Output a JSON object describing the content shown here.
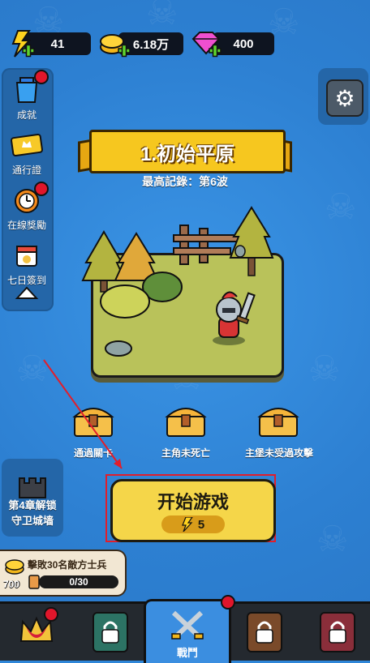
{
  "resources": {
    "energy": "41",
    "gold": "6.18万",
    "gems": "400"
  },
  "side_menu": {
    "items": [
      {
        "label": "成就",
        "icon": "achievement-icon"
      },
      {
        "label": "通行證",
        "icon": "pass-icon"
      },
      {
        "label": "在線獎勵",
        "icon": "online-reward-icon"
      },
      {
        "label": "七日簽到",
        "icon": "calendar-icon"
      }
    ]
  },
  "stage": {
    "title": "1.初始平原",
    "record": "最高記錄：第6波"
  },
  "chests": [
    {
      "label": "通過關卡"
    },
    {
      "label": "主角未死亡"
    },
    {
      "label": "主堡未受過攻擊"
    }
  ],
  "start": {
    "label": "开始游戏",
    "cost": "5"
  },
  "chapter_unlock": {
    "line1": "第4章解锁",
    "line2": "守卫城墙"
  },
  "quest": {
    "title": "擊敗30名敵方士兵",
    "reward": "700",
    "progress_text": "0/30",
    "progress": 0
  },
  "bottom_nav": {
    "battle_label": "戰鬥"
  },
  "colors": {
    "background": "#2f86d8",
    "accent_yellow": "#f5d649",
    "badge_red": "#e0162b"
  }
}
